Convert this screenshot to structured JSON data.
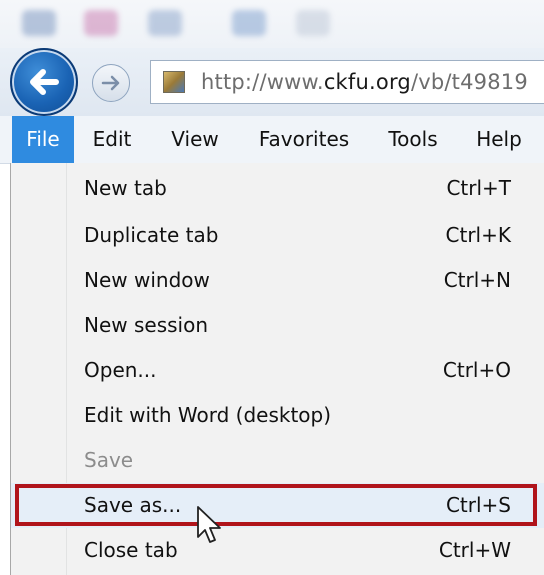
{
  "browser": {
    "url_prefix": "http://www.",
    "url_domain": "ckfu.org",
    "url_path": "/vb/t49819"
  },
  "menu_bar": {
    "items": [
      {
        "label": "File",
        "active": true
      },
      {
        "label": "Edit"
      },
      {
        "label": "View"
      },
      {
        "label": "Favorites"
      },
      {
        "label": "Tools"
      },
      {
        "label": "Help"
      }
    ]
  },
  "file_menu": {
    "items": [
      {
        "label": "New tab",
        "shortcut": "Ctrl+T"
      },
      {
        "label": "Duplicate tab",
        "shortcut": "Ctrl+K"
      },
      {
        "label": "New window",
        "shortcut": "Ctrl+N"
      },
      {
        "label": "New session",
        "shortcut": ""
      },
      {
        "label": "Open...",
        "shortcut": "Ctrl+O"
      },
      {
        "label": "Edit with Word (desktop)",
        "shortcut": ""
      },
      {
        "label": "Save",
        "shortcut": "",
        "disabled": true
      },
      {
        "label": "Save as...",
        "shortcut": "Ctrl+S",
        "highlighted": true
      },
      {
        "label": "Close tab",
        "shortcut": "Ctrl+W"
      }
    ]
  },
  "colors": {
    "menu_active_bg": "#2f8be0",
    "highlight_border": "#b0141b",
    "back_button": "#1a63b4"
  },
  "icons": {
    "back": "back-arrow-icon",
    "forward": "forward-arrow-icon",
    "favicon": "site-favicon",
    "cursor": "mouse-pointer-icon"
  }
}
